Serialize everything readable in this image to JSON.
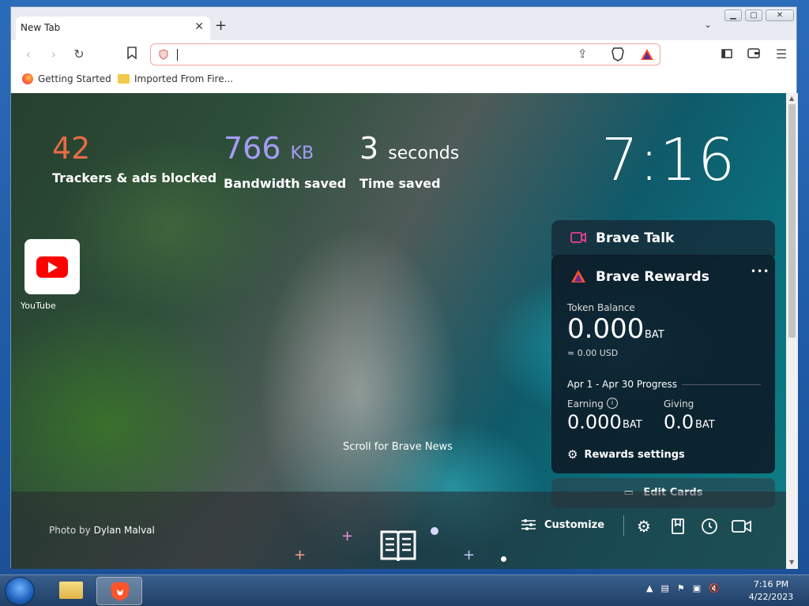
{
  "browser": {
    "tab_title": "New Tab",
    "url_value": "",
    "bookmarks": [
      {
        "label": "Getting Started",
        "icon": "firefox-icon"
      },
      {
        "label": "Imported From Fire...",
        "icon": "folder-icon"
      }
    ]
  },
  "stats": {
    "trackers_value": "42",
    "trackers_label": "Trackers & ads blocked",
    "bandwidth_value": "766",
    "bandwidth_unit": "KB",
    "bandwidth_label": "Bandwidth saved",
    "time_value": "3",
    "time_unit": "seconds",
    "time_label": "Time saved"
  },
  "clock": "7:16",
  "topsites": [
    {
      "label": "YouTube",
      "icon": "youtube-icon"
    }
  ],
  "talk": {
    "title": "Brave Talk"
  },
  "rewards": {
    "title": "Brave Rewards",
    "more": "•••",
    "token_label": "Token Balance",
    "token_value": "0.000",
    "token_unit": "BAT",
    "usd_value": "≈ 0.00 USD",
    "progress_label": "Apr 1 - Apr 30 Progress",
    "earning_label": "Earning",
    "earning_value": "0.000",
    "earning_unit": "BAT",
    "giving_label": "Giving",
    "giving_value": "0.0",
    "giving_unit": "BAT",
    "settings_label": "Rewards settings"
  },
  "edit_cards_label": "Edit Cards",
  "scroll_news": "Scroll for Brave News",
  "photo_credit_prefix": "Photo by",
  "photo_credit_name": "Dylan Malval",
  "customize_label": "Customize",
  "colors": {
    "accent_orange": "#e66c45",
    "accent_purple": "#a79cf5",
    "talk_pink": "#ef3e92",
    "rewards_orange": "#fb542b"
  },
  "taskbar": {
    "time": "7:16 PM",
    "date": "4/22/2023"
  }
}
